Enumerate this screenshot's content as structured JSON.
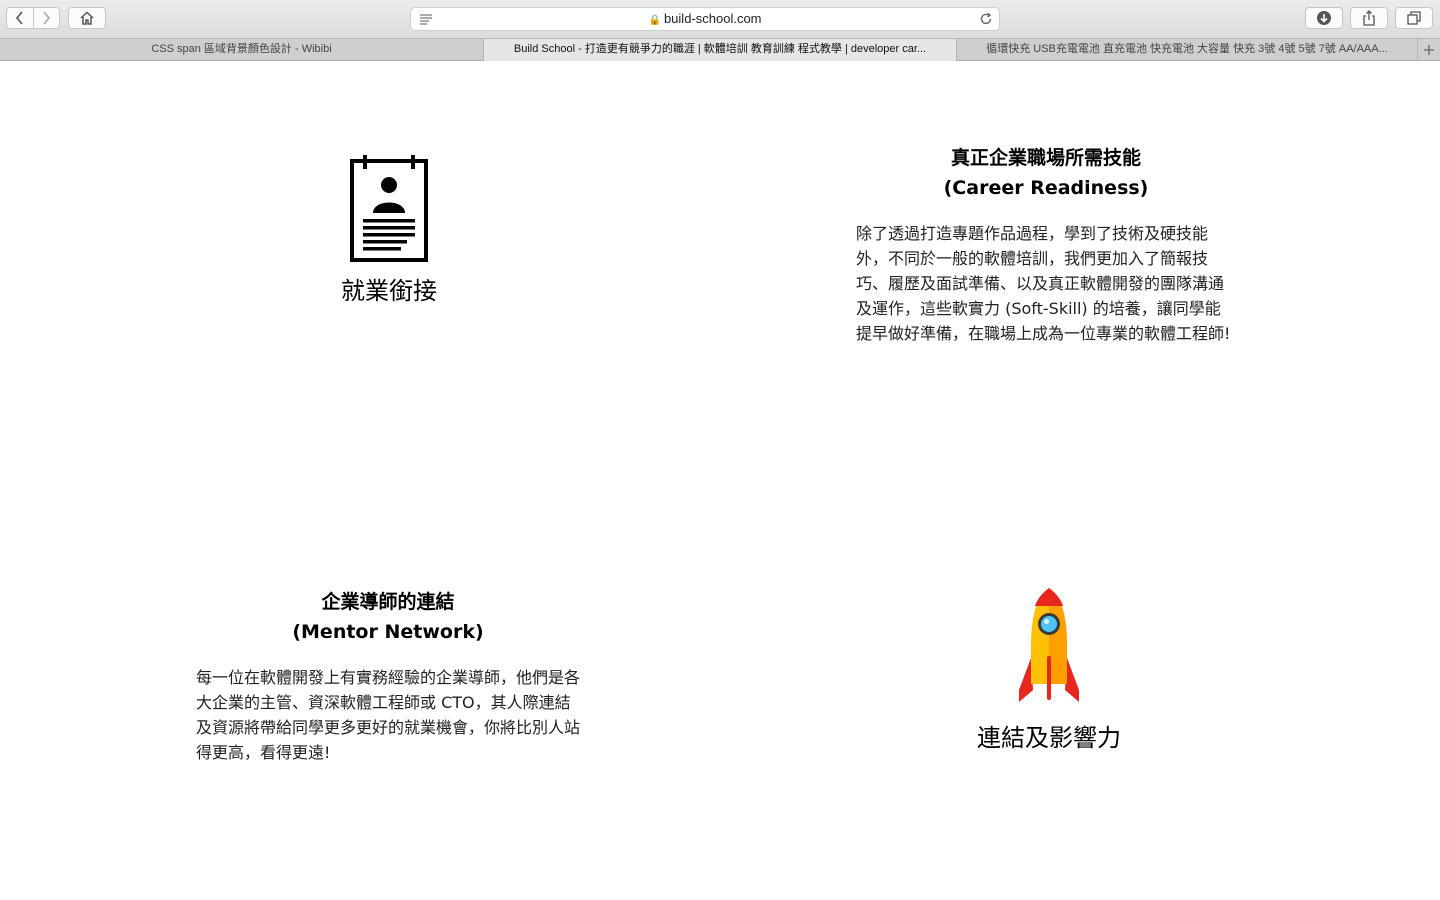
{
  "browser": {
    "url": "build-school.com",
    "tabs": [
      {
        "title": "CSS span 區域背景顏色設計 - Wibibi",
        "active": false
      },
      {
        "title": "Build School - 打造更有競爭力的職涯 | 軟體培訓 教育訓練 程式教學 | developer car...",
        "active": true
      },
      {
        "title": "循環快充 USB充電電池 直充電池 快充電池 大容量 快充 3號 4號 5號 7號 AA/AAA...",
        "active": false
      }
    ]
  },
  "sections": {
    "career": {
      "icon": "resume-icon",
      "label": "就業銜接",
      "title_zh": "真正企業職場所需技能",
      "title_en": "(Career Readiness)",
      "body": "除了透過打造專題作品過程，學到了技術及硬技能外，不同於一般的軟體培訓，我們更加入了簡報技巧、履歷及面試準備、以及真正軟體開發的團隊溝通及運作，這些軟實力 (Soft-Skill) 的培養，讓同學能提早做好準備，在職場上成為一位專業的軟體工程師!"
    },
    "mentor": {
      "icon": "rocket-icon",
      "label": "連結及影響力",
      "title_zh": "企業導師的連結",
      "title_en": "(Mentor Network)",
      "body": "每一位在軟體開發上有實務經驗的企業導師，他們是各大企業的主管、資深軟體工程師或 CTO，其人際連結及資源將帶給同學更多更好的就業機會，你將比別人站得更高，看得更遠!"
    }
  }
}
